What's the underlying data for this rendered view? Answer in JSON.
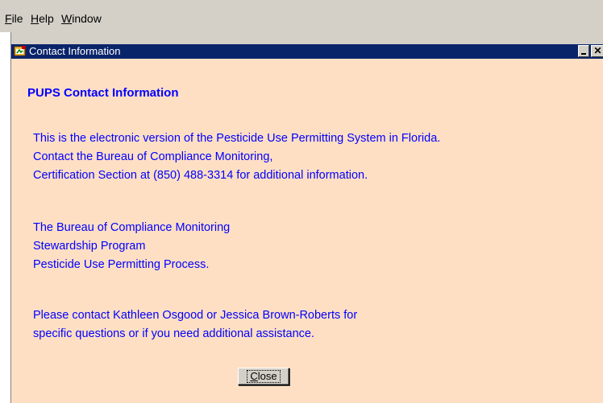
{
  "menubar": {
    "items": [
      {
        "label": "File",
        "mnemonic": "F",
        "rest": "ile"
      },
      {
        "label": "Help",
        "mnemonic": "H",
        "rest": "elp"
      },
      {
        "label": "Window",
        "mnemonic": "W",
        "rest": "indow"
      }
    ]
  },
  "window": {
    "title": "Contact Information",
    "icon": "app-window-icon"
  },
  "content": {
    "heading": "PUPS Contact Information",
    "paragraph1": [
      "This is the electronic version of the Pesticide Use Permitting System in Florida.",
      "Contact the Bureau of Compliance Monitoring,",
      "Certification Section at (850) 488-3314 for additional information."
    ],
    "paragraph2": [
      "The Bureau of Compliance Monitoring",
      "Stewardship Program",
      "Pesticide Use Permitting Process."
    ],
    "paragraph3": [
      "Please contact Kathleen Osgood or Jessica Brown-Roberts for",
      "specific questions or if you need additional assistance."
    ]
  },
  "buttons": {
    "close_label": "Close",
    "close_rest": "lose",
    "close_mnemonic": "C"
  },
  "colors": {
    "window_background": "#ffdfc4",
    "titlebar": "#0a246a",
    "text": "#0000ff"
  }
}
